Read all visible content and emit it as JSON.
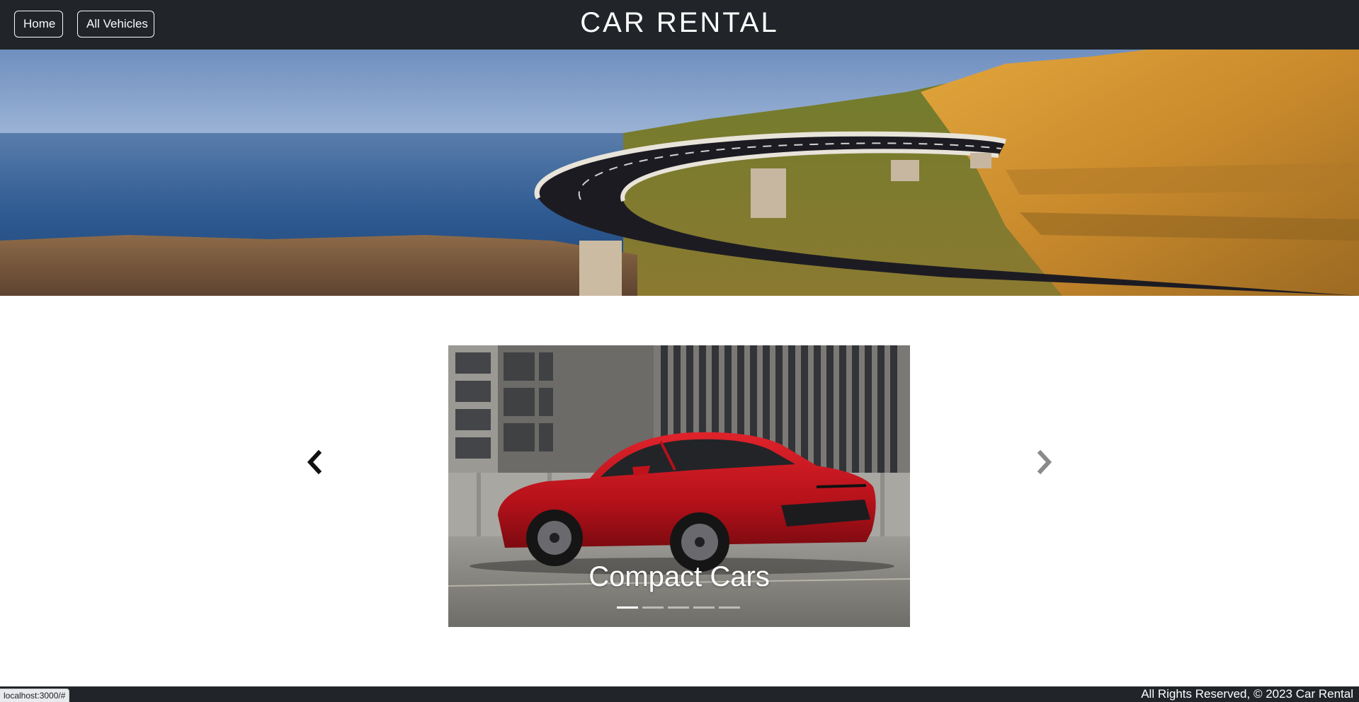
{
  "navbar": {
    "home_label": "Home",
    "vehicles_label": "All Vehicles",
    "brand": "CAR RENTAL"
  },
  "hero": {
    "image": "coastal-bridge-road-photo"
  },
  "carousel": {
    "prev_icon": "chevron-left-icon",
    "next_icon": "chevron-right-icon",
    "active_index": 0,
    "slide_count": 5,
    "slides": [
      {
        "caption": "Compact Cars",
        "image": "red-sedan-photo"
      }
    ]
  },
  "footer": {
    "text": "All Rights Reserved, © 2023 Car Rental"
  },
  "status_bar": {
    "url": "localhost:3000/#"
  },
  "colors": {
    "navbar_bg": "#212529",
    "nav_text": "#f8f9fa",
    "page_bg": "#ffffff",
    "car_red": "#c8141c"
  }
}
